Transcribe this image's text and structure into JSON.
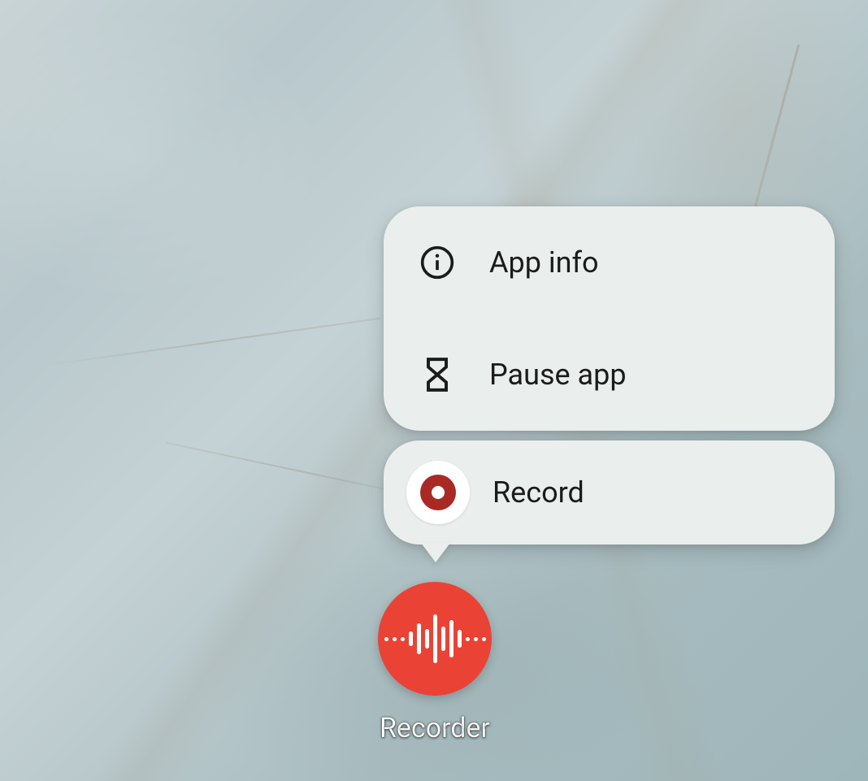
{
  "app": {
    "name": "Recorder"
  },
  "contextMenu": {
    "items": [
      {
        "label": "App info",
        "icon": "info-icon"
      },
      {
        "label": "Pause app",
        "icon": "hourglass-icon"
      }
    ],
    "shortcuts": [
      {
        "label": "Record",
        "icon": "record-icon"
      }
    ]
  },
  "colors": {
    "menuBg": "#eaeeed",
    "appIconBg": "#ea4335",
    "recordRed": "#a92a24",
    "text": "#1a1c1b"
  }
}
